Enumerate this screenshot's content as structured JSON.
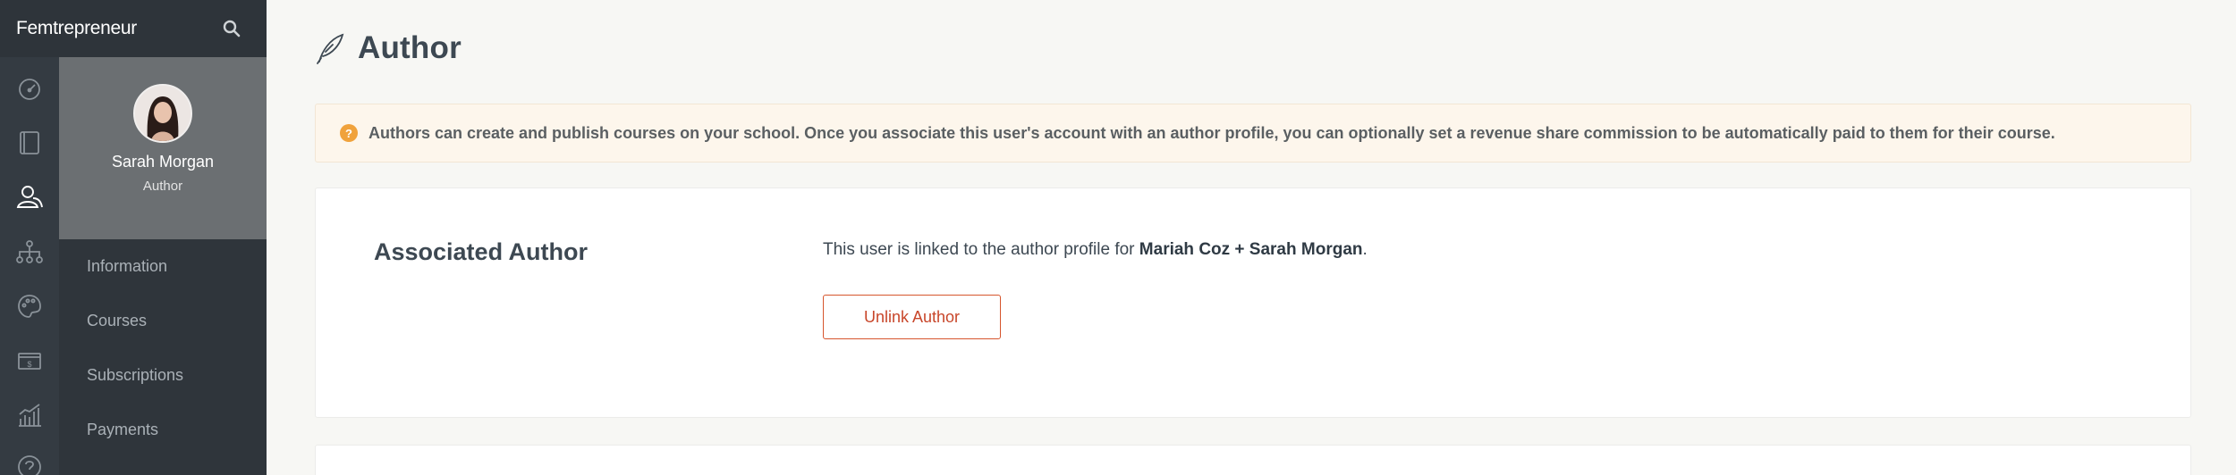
{
  "app": {
    "brand": "Femtrepreneur"
  },
  "rail": {
    "items": [
      {
        "icon": "dashboard-gauge-icon"
      },
      {
        "icon": "book-icon"
      },
      {
        "icon": "users-icon",
        "active": true
      },
      {
        "icon": "sitemap-icon"
      },
      {
        "icon": "palette-icon"
      },
      {
        "icon": "money-icon"
      },
      {
        "icon": "chart-icon"
      },
      {
        "icon": "help-icon"
      }
    ]
  },
  "profile": {
    "name": "Sarah Morgan",
    "role": "Author"
  },
  "subnav": {
    "items": [
      {
        "label": "Information"
      },
      {
        "label": "Courses"
      },
      {
        "label": "Subscriptions"
      },
      {
        "label": "Payments"
      }
    ]
  },
  "page": {
    "title": "Author",
    "title_icon": "quill-icon"
  },
  "notice": {
    "icon": "question-icon",
    "text": "Authors can create and publish courses on your school. Once you associate this user's account with an author profile, you can optionally set a revenue share commission to be automatically paid to them for their course."
  },
  "associated_author": {
    "title": "Associated Author",
    "text_prefix": "This user is linked to the author profile for ",
    "author_name": "Mariah Coz + Sarah Morgan",
    "text_suffix": ".",
    "unlink_label": "Unlink Author"
  },
  "colors": {
    "brand_bar": "#2e343a",
    "rail": "#343b42",
    "subnav": "#2f353b",
    "profile_bg": "#6b6f72",
    "notice_bg": "#fdf6ec",
    "notice_icon": "#f0a23c",
    "danger": "#c8462a"
  }
}
